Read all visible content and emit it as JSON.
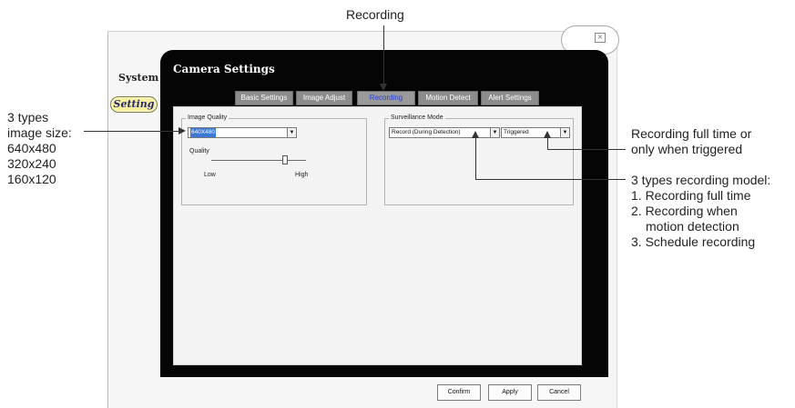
{
  "annotations": {
    "recording_top": "Recording",
    "image_size": [
      "3 types",
      "image size:",
      "640x480",
      "320x240",
      "160x120"
    ],
    "trigger": [
      "Recording full time or",
      "only when triggered"
    ],
    "model": [
      "3 types recording model:",
      "1. Recording full time",
      "2. Recording when",
      "motion detection",
      "3. Schedule recording"
    ]
  },
  "sidebar": {
    "system": "System",
    "setting": "Setting"
  },
  "panel": {
    "title": "Camera Settings"
  },
  "tabs": [
    {
      "label": "Basic Settings",
      "active": false
    },
    {
      "label": "Image Adjust",
      "active": false
    },
    {
      "label": "Recording",
      "active": true
    },
    {
      "label": "Motion Detect",
      "active": false
    },
    {
      "label": "Alert Settings",
      "active": false
    }
  ],
  "image_quality": {
    "legend": "Image Quality",
    "resolution": "640X480",
    "quality_label": "Quality",
    "low": "Low",
    "high": "High"
  },
  "surveillance": {
    "legend": "Surveillance Mode",
    "mode": "Record (During Detection)",
    "trigger": "Triggered"
  },
  "buttons": {
    "confirm": "Confirm",
    "apply": "Apply",
    "cancel": "Cancel"
  },
  "colors": {
    "panel_bg": "#050505",
    "tab_active_text": "#2a3fd0",
    "selected_bg": "#3a78d6",
    "setting_pill": "#f5f0a0"
  }
}
